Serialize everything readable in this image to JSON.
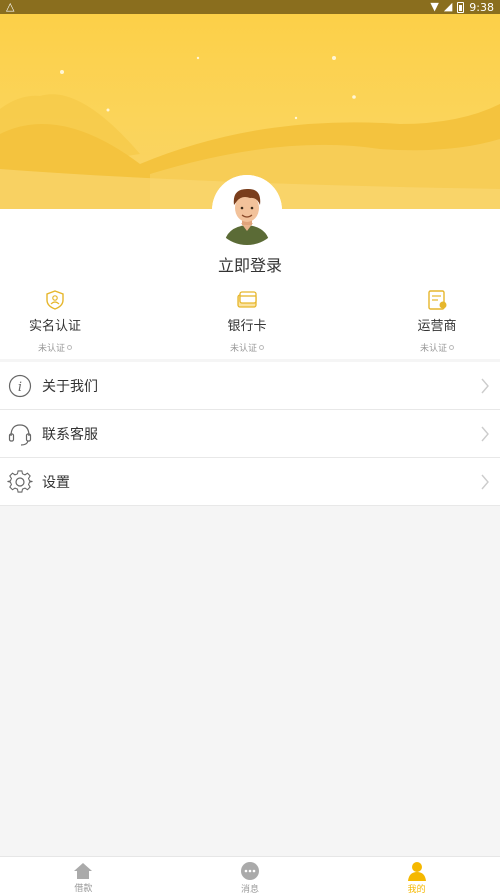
{
  "status_bar": {
    "left_icon": "a-notification-icon",
    "time": "9:38"
  },
  "profile": {
    "login_label": "立即登录"
  },
  "verifications": [
    {
      "label": "实名认证",
      "status": "未认证",
      "icon": "id-verify-icon"
    },
    {
      "label": "银行卡",
      "status": "未认证",
      "icon": "bank-card-icon"
    },
    {
      "label": "运营商",
      "status": "未认证",
      "icon": "carrier-icon"
    }
  ],
  "menu": [
    {
      "label": "关于我们",
      "icon": "info-icon"
    },
    {
      "label": "联系客服",
      "icon": "headset-icon"
    },
    {
      "label": "设置",
      "icon": "gear-icon"
    }
  ],
  "tabbar": [
    {
      "label": "借款",
      "icon": "home-icon",
      "active": false
    },
    {
      "label": "消息",
      "icon": "message-icon",
      "active": false
    },
    {
      "label": "我的",
      "icon": "person-icon",
      "active": true
    }
  ],
  "colors": {
    "accent": "#f5b800",
    "header_yellow": "#fcd048",
    "status_bar": "#8a6e1e"
  }
}
